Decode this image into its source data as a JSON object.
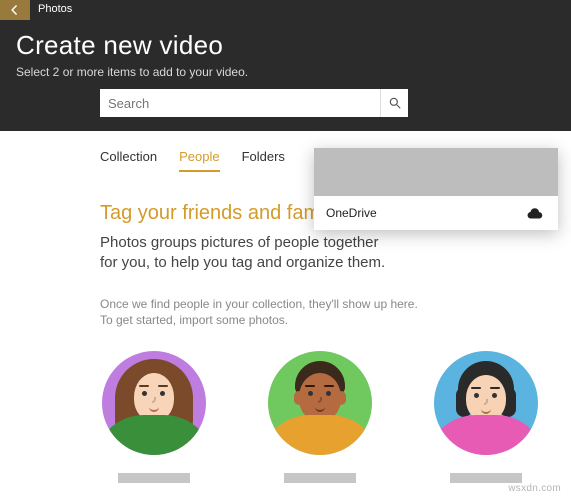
{
  "app": {
    "title": "Photos"
  },
  "header": {
    "title": "Create new video",
    "subtitle": "Select 2 or more items to add to your video."
  },
  "search": {
    "placeholder": "Search"
  },
  "tabs": {
    "collection": "Collection",
    "people": "People",
    "folders": "Folders"
  },
  "people_section": {
    "heading": "Tag your friends and family",
    "description": "Photos groups pictures of people together for you, to help you tag and organize them.",
    "hint1": "Once we find people in your collection, they'll show up here.",
    "hint2": "To get started, import some photos."
  },
  "dropdown": {
    "label": "OneDrive"
  },
  "watermark": "wsxdn.com"
}
